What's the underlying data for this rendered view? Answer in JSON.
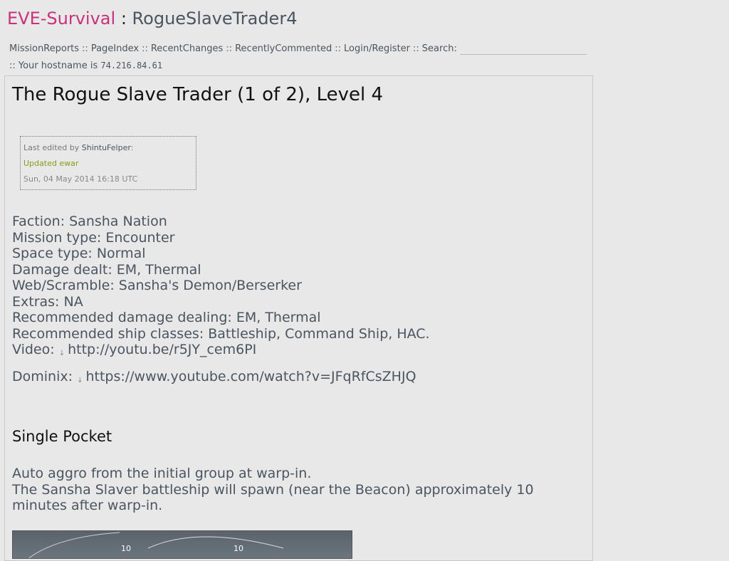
{
  "header": {
    "site_name": "EVE-Survival",
    "separator": ":",
    "page_name": "RogueSlaveTrader4"
  },
  "nav": {
    "items": [
      "MissionReports",
      "PageIndex",
      "RecentChanges",
      "RecentlyCommented",
      "Login/Register"
    ],
    "search_label": "Search:",
    "separator": "::",
    "host_prefix": ":: Your hostname is",
    "host_ip": "74.216.84.61"
  },
  "article": {
    "title": "The Rogue Slave Trader (1 of 2), Level 4",
    "edit": {
      "prefix": "Last edited by",
      "author": "ShintuFelper",
      "suffix": ":",
      "note": "Updated ewar",
      "date": "Sun, 04 May 2014 16:18 UTC"
    },
    "info_lines": [
      "Faction: Sansha Nation",
      "Mission type: Encounter",
      "Space type: Normal",
      "Damage dealt: EM, Thermal",
      "Web/Scramble: Sansha's Demon/Berserker",
      "Extras: NA",
      "Recommended damage dealing: EM, Thermal",
      "Recommended ship classes: Battleship, Command Ship, HAC."
    ],
    "video_label": "Video:",
    "video_link": "http://youtu.be/r5JY_cem6PI",
    "dominix_label": "Dominix:",
    "dominix_link": "https://www.youtube.com/watch?v=JFqRfCsZHJQ",
    "section_heading": "Single Pocket",
    "desc_line1": "Auto aggro from the initial group at warp-in.",
    "desc_line2": "The Sansha Slaver battleship will spawn (near the Beacon) approximately 10 minutes after warp-in.",
    "screenshot_labels": [
      "10",
      "10"
    ]
  }
}
